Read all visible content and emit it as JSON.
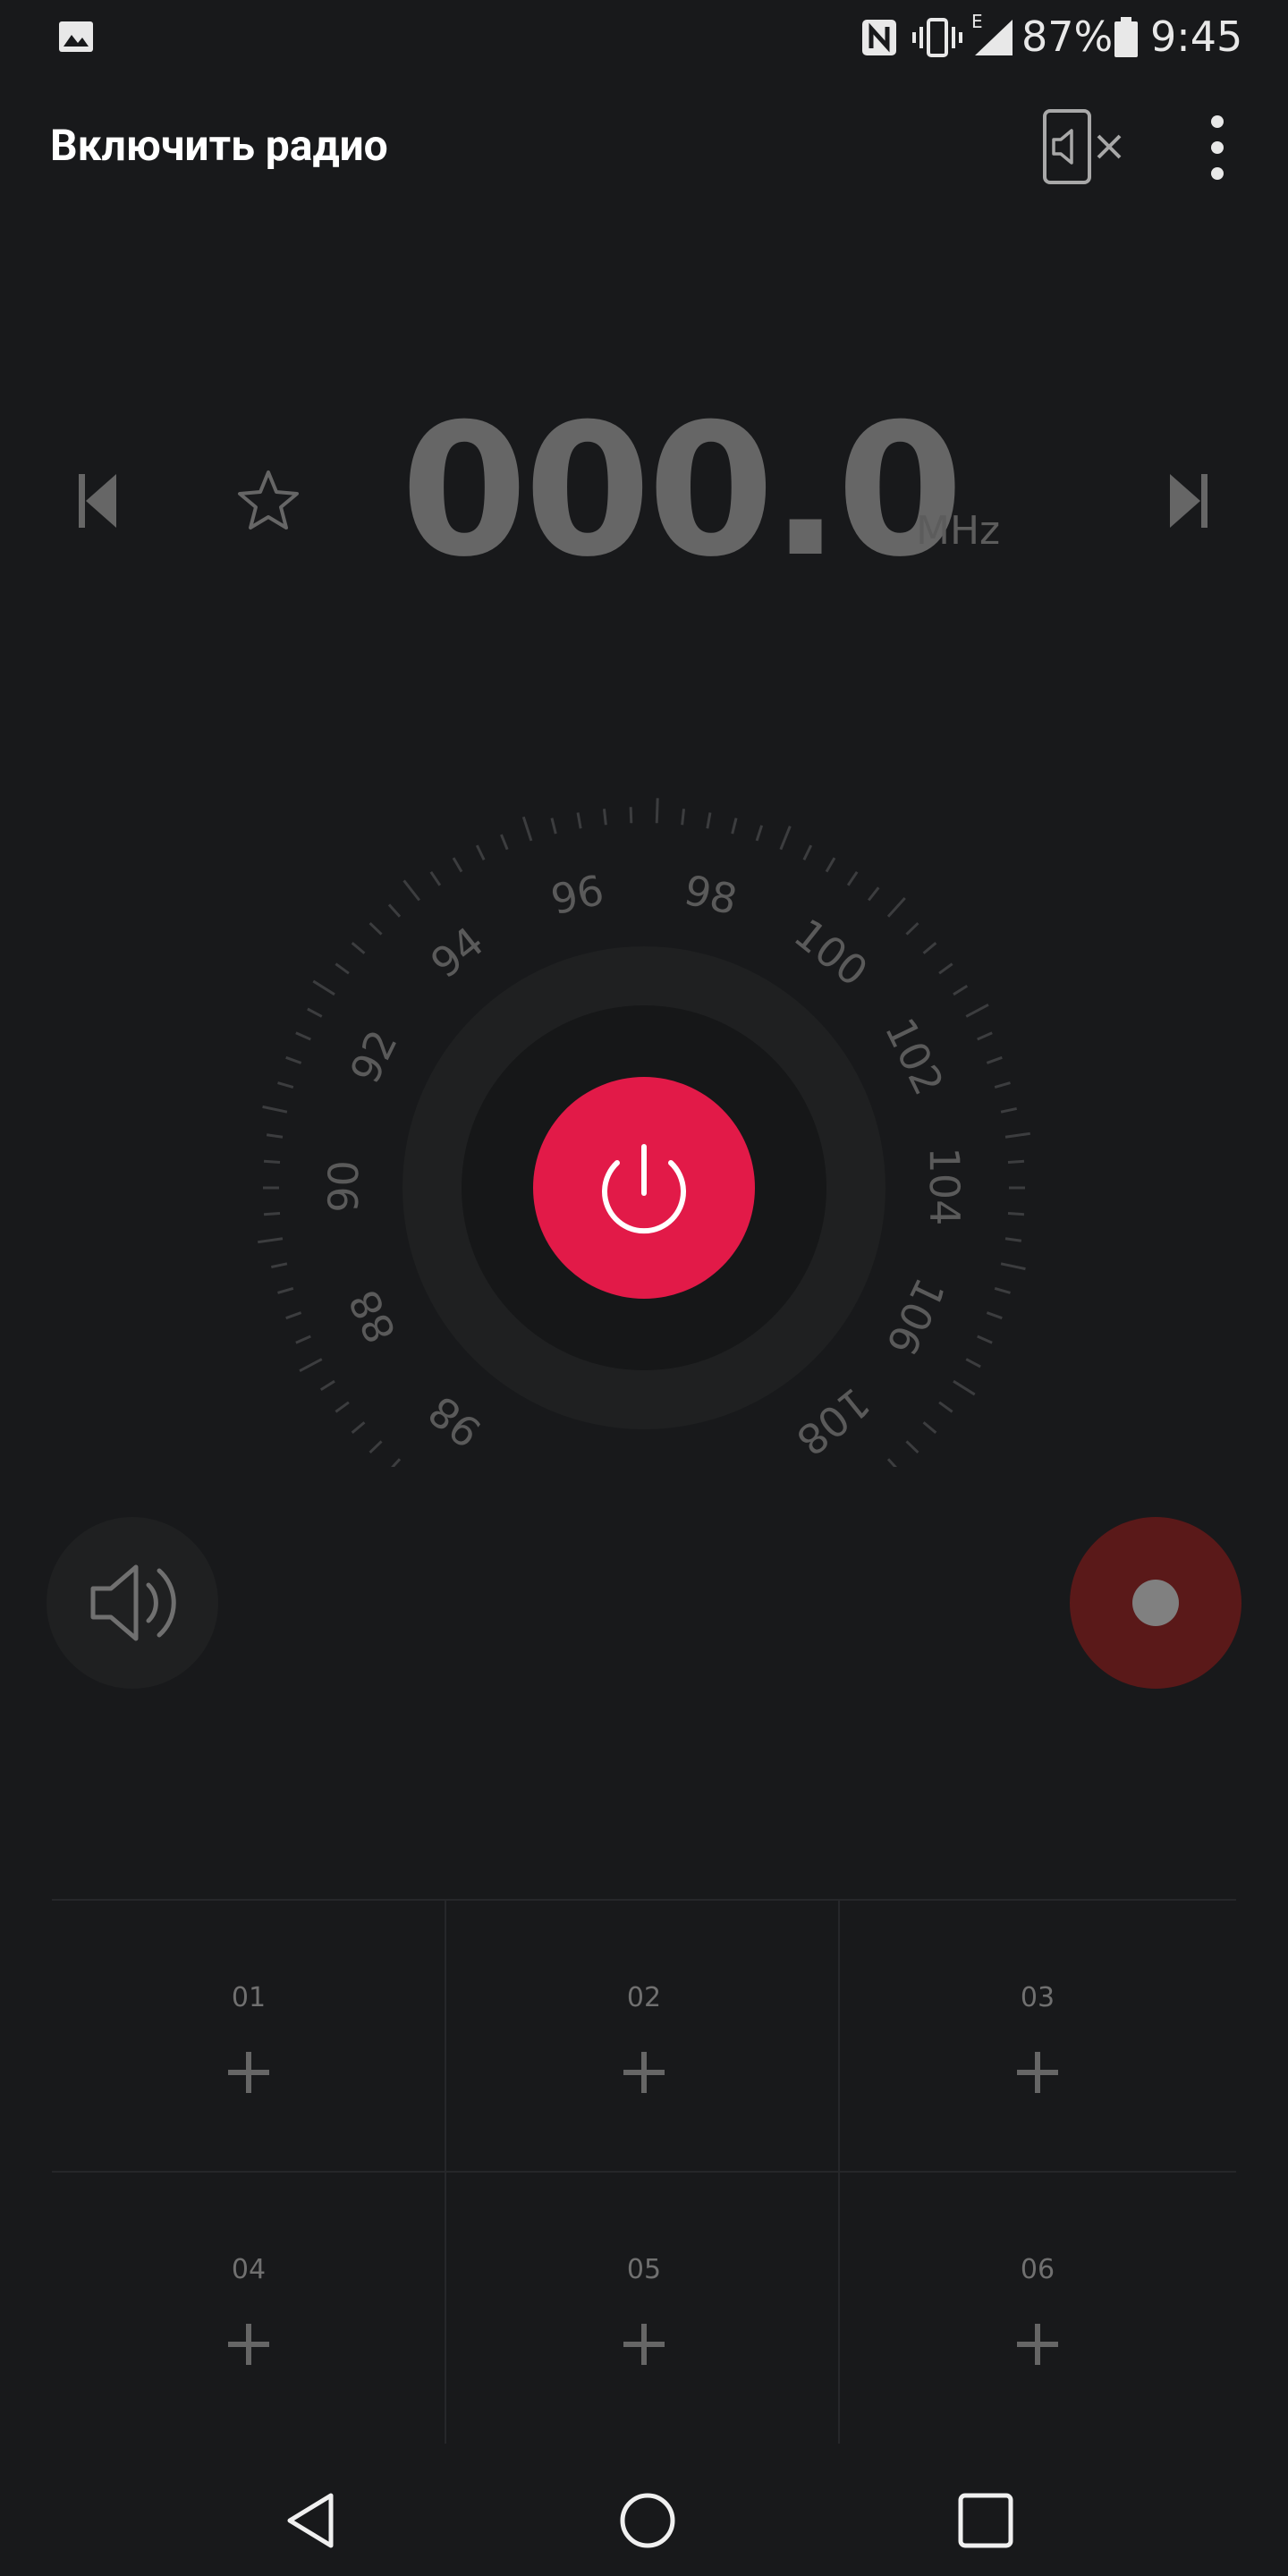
{
  "status_bar": {
    "notification_icon": "image-icon",
    "nfc_icon": "nfc-icon",
    "vibrate_icon": "vibrate-icon",
    "network_type": "E",
    "signal_icon": "signal-icon",
    "battery_percent": "87%",
    "battery_level": 0.87,
    "battery_icon": "battery-icon",
    "time": "9:45"
  },
  "app_bar": {
    "title": "Включить радио",
    "speaker_mute_icon": "phone-speaker-off-icon",
    "menu_icon": "more-vert-icon"
  },
  "tuner": {
    "frequency": "000.0",
    "unit": "MHz",
    "prev_icon": "skip-previous-icon",
    "favorite_icon": "star-outline-icon",
    "next_icon": "skip-next-icon"
  },
  "dial": {
    "labels": [
      "98",
      "88",
      "90",
      "92",
      "94",
      "96",
      "98",
      "100",
      "102",
      "104",
      "106",
      "108"
    ],
    "power_icon": "power-icon",
    "accent_color": "#e21a48"
  },
  "controls": {
    "speaker_icon": "speaker-icon",
    "record_icon": "record-icon",
    "record_color": "#5a1919"
  },
  "presets": [
    {
      "number": "01"
    },
    {
      "number": "02"
    },
    {
      "number": "03"
    },
    {
      "number": "04"
    },
    {
      "number": "05"
    },
    {
      "number": "06"
    }
  ],
  "nav_bar": {
    "back_icon": "back-icon",
    "home_icon": "home-icon",
    "recents_icon": "recents-icon"
  }
}
